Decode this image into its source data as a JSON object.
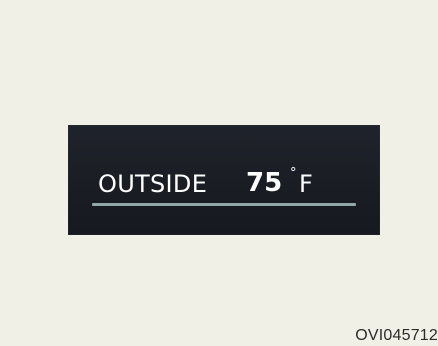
{
  "display": {
    "label": "OUTSIDE",
    "temperature": "75",
    "degree_symbol": "°",
    "unit": "F",
    "colors": {
      "page_background": "#f0f0e6",
      "panel_background": "#1c2027",
      "text": "#ffffff",
      "underline": "#8fa8aa"
    }
  },
  "figure_code": "OVI045712"
}
